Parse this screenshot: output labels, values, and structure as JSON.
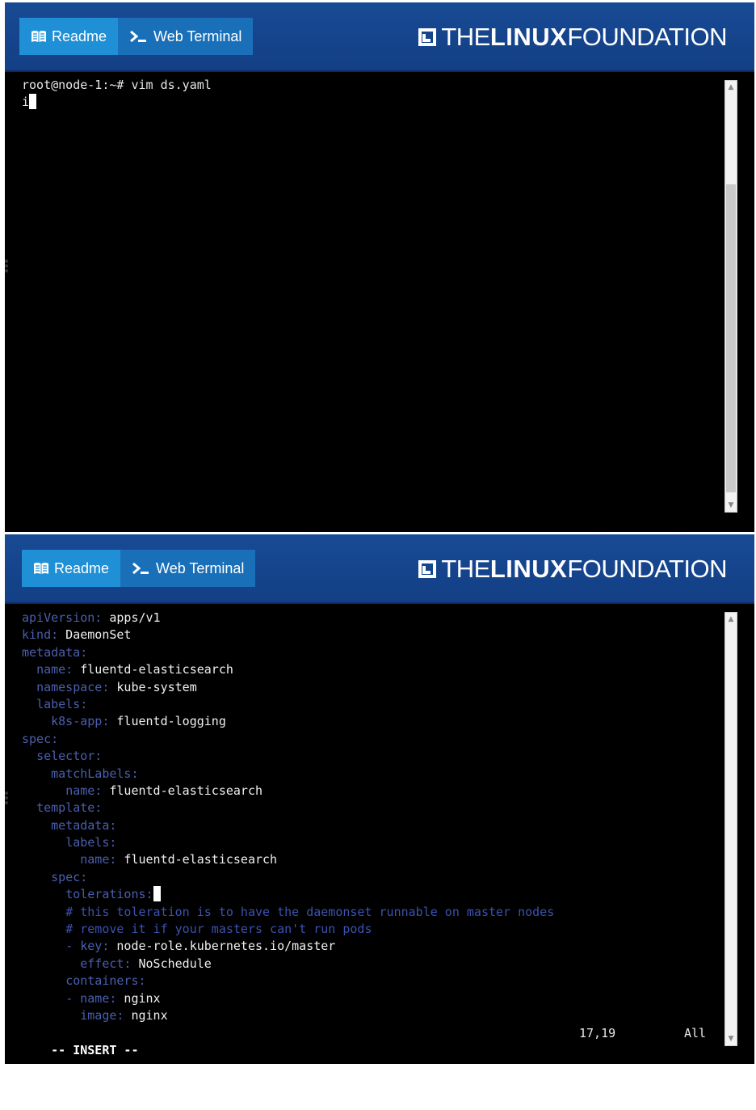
{
  "header": {
    "tabs": [
      {
        "label": "Readme",
        "icon": "book-icon"
      },
      {
        "label": "Web Terminal",
        "icon": "terminal-prompt-icon"
      }
    ],
    "logo": {
      "the": "THE",
      "linux": "LINUX",
      "foundation": "FOUNDATION"
    }
  },
  "terminal1": {
    "lines": [
      "root@node-1:~# vim ds.yaml",
      "i"
    ]
  },
  "terminal2": {
    "lines": [
      {
        "indent": "",
        "key": "apiVersion:",
        "value": " apps/v1"
      },
      {
        "indent": "",
        "key": "kind:",
        "value": " DaemonSet"
      },
      {
        "indent": "",
        "key": "metadata:",
        "value": ""
      },
      {
        "indent": "  ",
        "key": "name:",
        "value": " fluentd-elasticsearch"
      },
      {
        "indent": "  ",
        "key": "namespace:",
        "value": " kube-system"
      },
      {
        "indent": "  ",
        "key": "labels:",
        "value": ""
      },
      {
        "indent": "    ",
        "key": "k8s-app:",
        "value": " fluentd-logging"
      },
      {
        "indent": "",
        "key": "spec:",
        "value": ""
      },
      {
        "indent": "  ",
        "key": "selector:",
        "value": ""
      },
      {
        "indent": "    ",
        "key": "matchLabels:",
        "value": ""
      },
      {
        "indent": "      ",
        "key": "name:",
        "value": " fluentd-elasticsearch"
      },
      {
        "indent": "  ",
        "key": "template:",
        "value": ""
      },
      {
        "indent": "    ",
        "key": "metadata:",
        "value": ""
      },
      {
        "indent": "      ",
        "key": "labels:",
        "value": ""
      },
      {
        "indent": "        ",
        "key": "name:",
        "value": " fluentd-elasticsearch"
      },
      {
        "indent": "    ",
        "key": "spec:",
        "value": ""
      },
      {
        "indent": "      ",
        "key": "tolerations:",
        "value": "",
        "cursor": true
      },
      {
        "indent": "      ",
        "key": "# this toleration is to have the daemonset runnable on master nodes",
        "value": "",
        "comment": true
      },
      {
        "indent": "      ",
        "key": "# remove it if your masters can't run pods",
        "value": "",
        "comment": true
      },
      {
        "indent": "      ",
        "dash": "- ",
        "key": "key:",
        "value": " node-role.kubernetes.io/master"
      },
      {
        "indent": "        ",
        "key": "effect:",
        "value": " NoSchedule"
      },
      {
        "indent": "      ",
        "key": "containers:",
        "value": ""
      },
      {
        "indent": "      ",
        "dash": "- ",
        "key": "name:",
        "value": " nginx"
      },
      {
        "indent": "        ",
        "key": "image:",
        "value": " nginx"
      }
    ],
    "status": {
      "mode": "-- INSERT --",
      "position": "17,19",
      "scroll": "All"
    }
  },
  "colors": {
    "header_bg": "#184a94",
    "readme_tab": "#1f8fd6",
    "terminal_tab": "#1a70b8",
    "yaml_key": "#4a5fae"
  }
}
